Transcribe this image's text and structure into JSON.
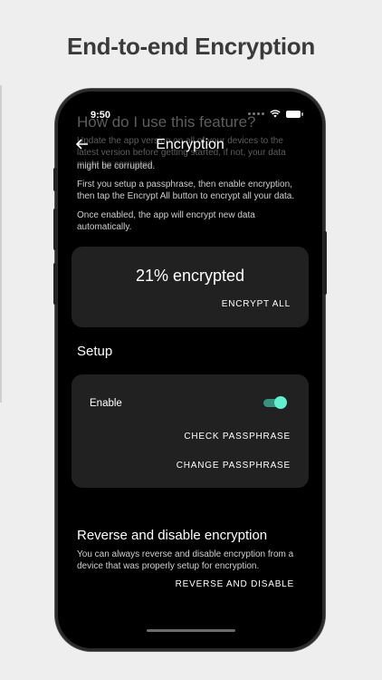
{
  "promo": {
    "title": "End-to-end Encryption"
  },
  "status": {
    "time": "9:50"
  },
  "nav": {
    "back_icon": "arrow-left-icon",
    "title": "Encryption"
  },
  "help": {
    "heading": "How do I use this feature?",
    "faded_text": "Update the app version on all of your devices to the latest version before getting started, if not, your data might be corrupted.",
    "corrupted_line": "might be corrupted.",
    "step1": "First you setup a passphrase, then enable encryption, then tap the Encrypt All button to encrypt all your data.",
    "step2": "Once enabled, the app will encrypt new data automatically."
  },
  "progress": {
    "percent_label": "21% encrypted",
    "percent": 21,
    "encrypt_all_label": "ENCRYPT ALL"
  },
  "setup": {
    "title": "Setup",
    "enable_label": "Enable",
    "enabled": true,
    "check_label": "CHECK PASSPHRASE",
    "change_label": "CHANGE PASSPHRASE"
  },
  "reverse": {
    "title": "Reverse and disable encryption",
    "description": "You can always reverse and disable encryption from a device that was properly setup for encryption.",
    "button_label": "REVERSE AND DISABLE"
  },
  "colors": {
    "toggle_knob": "#5ef0cf",
    "toggle_track": "#38917e",
    "card": "#212121"
  }
}
